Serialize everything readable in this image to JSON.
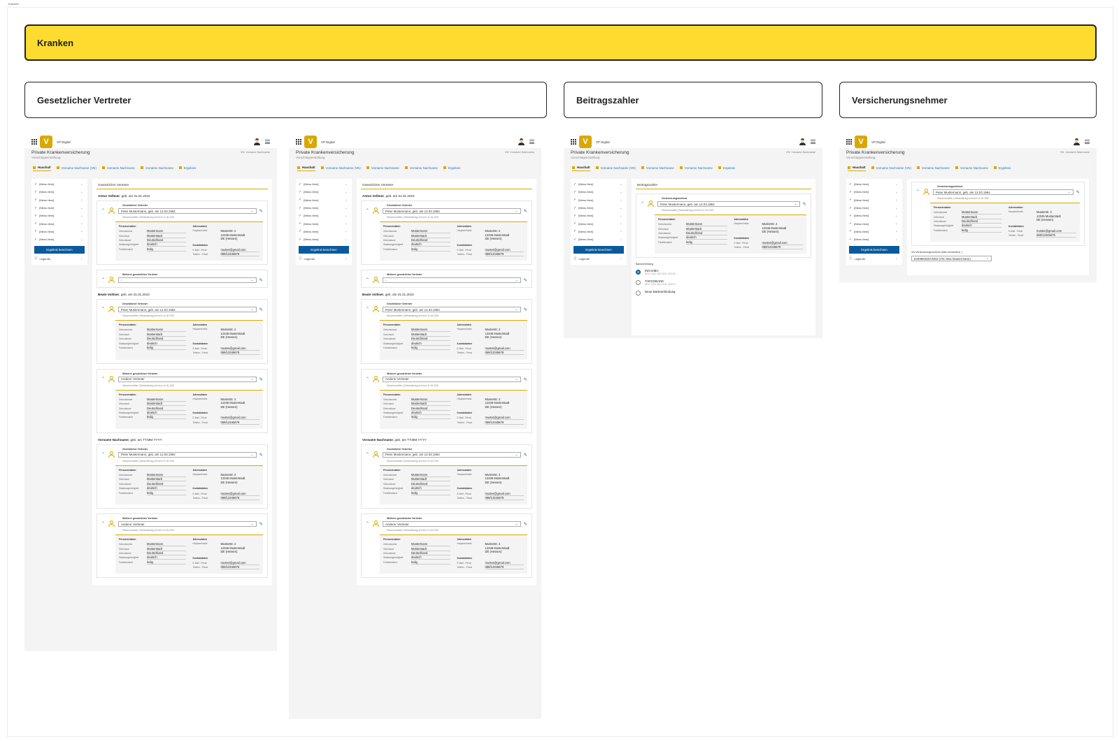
{
  "tiny_label": "Kranken",
  "banner": {
    "title": "Kranken"
  },
  "sections": [
    {
      "title": "Gesetzlicher Vertreter"
    },
    {
      "title": "Beitragszahler"
    },
    {
      "title": "Versicherungsnehmer"
    }
  ],
  "app": {
    "name": "VP Digital",
    "page_title": "Private Krankenversicherung",
    "page_subtitle": "Vorschlagserstellung",
    "vn_label": "VN: Vorname Nachname",
    "logo_letter": "V"
  },
  "tabs": [
    "Haushalt",
    "Vorname Nachname (VN)",
    "Vorname Nachname",
    "Vorname Nachname",
    "Ergebnis"
  ],
  "sidebar": {
    "item_label": "[Menu Item]",
    "calc_button": "Ergebnis berechnen",
    "legend": "Legende"
  },
  "details_template": {
    "personal_head": "Personendaten",
    "address_head": "Adressdaten",
    "contact_head": "Kontaktdaten",
    "birthname_k": "Geburtsname",
    "birthname_v": "Mustermann",
    "birthplace_k": "Geburtsort",
    "birthplace_v": "Musterstadt",
    "birthcountry_k": "Geburtsland",
    "birthcountry_v": "Deutschland",
    "nationality_k": "Staatsangehörigkeit",
    "nationality_v": "deutsch",
    "status_k": "Familienstand",
    "status_v": "ledig",
    "mainres_k": "Hauptwohnsitz",
    "addr1": "Musterstr. 2",
    "addr2": "12345 Musterstadt",
    "addr3": "DE (Hessen)",
    "email_k": "E-Mail - Privat",
    "email_v": "muster@gmail.com",
    "phone_k": "Telefon - Privat",
    "phone_v": "069/12345678"
  },
  "screen_gv": {
    "section_title": "Gesetzlicher Vertreter",
    "rep_label": "Gesetzlicher Vertreter",
    "rep_label_more": "Weiterer gesetzlicher Vertreter",
    "rep_value": "Peter Mustermann, geb. am 12.03.1964",
    "rep_other": "Anderer Vertreter",
    "rep_empty": "-",
    "rep_meta": "Wissenschaftler (Selbstständig) seit dem 11.06.2020",
    "persons": [
      {
        "name": "Anton Vollmer",
        "dob": ", geb. am 01.01.2010"
      },
      {
        "name": "Beate Vollmer",
        "dob": ", geb. am 01.01.2010"
      },
      {
        "name": "Vorname Nachname",
        "dob": ", geb. am TT.MM.YYYY"
      }
    ]
  },
  "screen_bz": {
    "section_title": "Beitragszahler",
    "rep_label": "Versicherungsnehmer",
    "rep_value": "Peter Mustermann, geb. am 12.03.1964",
    "rep_meta": "Wissenschaftler (Selbstständig) seit dem 11.06.2020",
    "bank_label": "Bankverbindung",
    "banks": [
      {
        "name": "ING-DIBA",
        "iban": "DE47 1234 4321 0011 1234 00",
        "selected": true
      },
      {
        "name": "TARGOBANK",
        "iban": "DE47 1234 4321 0011 1234 01",
        "selected": false
      },
      {
        "name": "Neue Bankverbindung",
        "iban": "",
        "selected": false
      }
    ]
  },
  "screen_vn": {
    "rep_label": "Versicherungsnehmer",
    "rep_value": "Peter Mustermann, geb. am 12.03.1964",
    "rep_meta": "Wissenschaftler (Selbstständig) seit dem 11.06.2020",
    "vn_number_label": "VN-Versicherungsnummer (falls vorhanden)",
    "vn_number_value": "63498634573453 (VN: Max Mustermann)"
  }
}
